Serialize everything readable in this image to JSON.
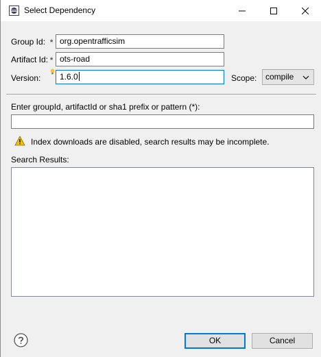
{
  "window": {
    "title": "Select Dependency"
  },
  "form": {
    "group_id_label": "Group Id:",
    "group_id_value": "org.opentrafficsim",
    "artifact_id_label": "Artifact Id:",
    "artifact_id_value": "ots-road",
    "version_label": "Version:",
    "version_value": "1.6.0",
    "scope_label": "Scope:",
    "scope_value": "compile",
    "required_marker": "*"
  },
  "search": {
    "prompt_label": "Enter groupId, artifactId or sha1 prefix or pattern (*):",
    "query_value": "",
    "warning_text": "Index downloads are disabled, search results may be incomplete.",
    "results_label": "Search Results:"
  },
  "buttons": {
    "ok_label": "OK",
    "cancel_label": "Cancel"
  },
  "icons": {
    "app": "eclipse-icon",
    "minimize": "minimize-icon",
    "maximize": "maximize-icon",
    "close": "close-icon",
    "warning": "warning-icon",
    "help": "help-icon",
    "dropdown": "chevron-down-icon"
  },
  "colors": {
    "focus_border": "#0078d7",
    "warning_fill": "#f2c200"
  }
}
